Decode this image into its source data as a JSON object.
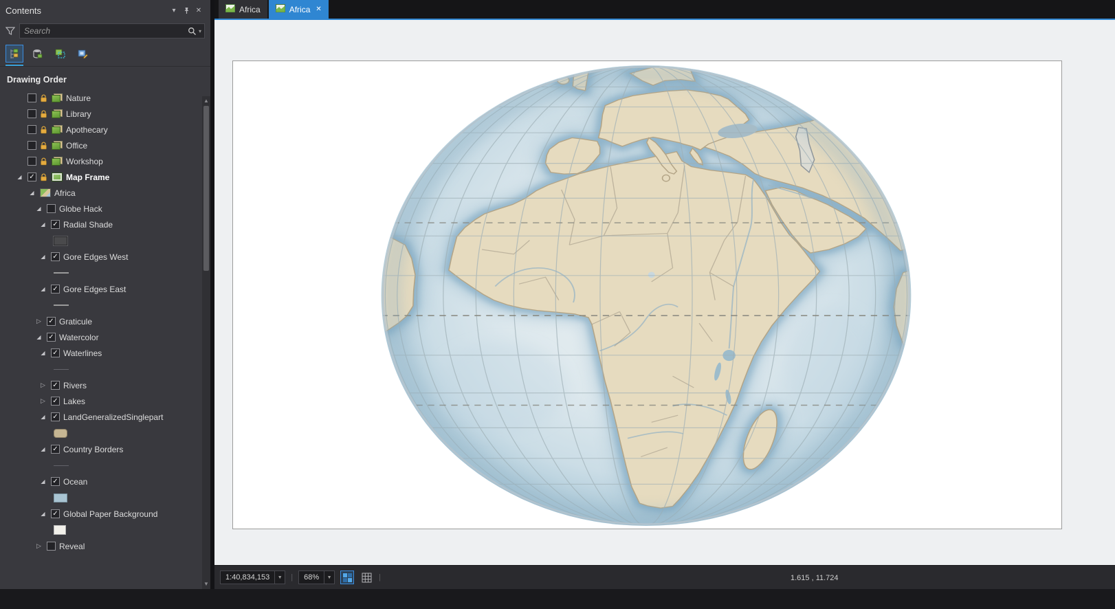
{
  "colors": {
    "accent": "#2f86d2",
    "panel_bg": "#39393e",
    "land": "#e6dbbf",
    "ocean_edge": "#9dbdd0"
  },
  "contents_panel": {
    "title": "Contents",
    "search_placeholder": "Search",
    "heading": "Drawing Order",
    "toolbar": [
      {
        "name": "list-by-drawing-order",
        "selected": true
      },
      {
        "name": "list-by-data-source",
        "selected": false
      },
      {
        "name": "list-by-selection",
        "selected": false
      },
      {
        "name": "list-by-editing",
        "selected": false
      }
    ],
    "tree": [
      {
        "label": "Nature",
        "level": 1,
        "expander": "none",
        "checkbox": false,
        "lock": true,
        "icon": "group",
        "bold": false,
        "swatch": null
      },
      {
        "label": "Library",
        "level": 1,
        "expander": "none",
        "checkbox": false,
        "lock": true,
        "icon": "group",
        "bold": false,
        "swatch": null
      },
      {
        "label": "Apothecary",
        "level": 1,
        "expander": "none",
        "checkbox": false,
        "lock": true,
        "icon": "group",
        "bold": false,
        "swatch": null
      },
      {
        "label": "Office",
        "level": 1,
        "expander": "none",
        "checkbox": false,
        "lock": true,
        "icon": "group",
        "bold": false,
        "swatch": null
      },
      {
        "label": "Workshop",
        "level": 1,
        "expander": "none",
        "checkbox": false,
        "lock": true,
        "icon": "group",
        "bold": false,
        "swatch": null
      },
      {
        "label": "Map Frame",
        "level": 1,
        "expander": "open",
        "checkbox": true,
        "lock": true,
        "icon": "frame",
        "bold": true,
        "swatch": null
      },
      {
        "label": "Africa",
        "level": 2,
        "expander": "open",
        "checkbox": null,
        "lock": false,
        "icon": "map",
        "bold": false,
        "swatch": null
      },
      {
        "label": "Globe Hack",
        "level": 3,
        "expander": "open",
        "checkbox": false,
        "lock": false,
        "icon": null,
        "bold": false,
        "swatch": null
      },
      {
        "label": "Radial Shade",
        "level": 4,
        "expander": "open",
        "checkbox": true,
        "lock": false,
        "icon": null,
        "bold": false,
        "swatch": "dark"
      },
      {
        "label": "Gore Edges West",
        "level": 4,
        "expander": "open",
        "checkbox": true,
        "lock": false,
        "icon": null,
        "bold": false,
        "swatch": "line"
      },
      {
        "label": "Gore Edges East",
        "level": 4,
        "expander": "open",
        "checkbox": true,
        "lock": false,
        "icon": null,
        "bold": false,
        "swatch": "line"
      },
      {
        "label": "Graticule",
        "level": 3,
        "expander": "closed",
        "checkbox": true,
        "lock": false,
        "icon": null,
        "bold": false,
        "swatch": null
      },
      {
        "label": "Watercolor",
        "level": 3,
        "expander": "open",
        "checkbox": true,
        "lock": false,
        "icon": null,
        "bold": false,
        "swatch": null
      },
      {
        "label": "Waterlines",
        "level": 4,
        "expander": "open",
        "checkbox": true,
        "lock": false,
        "icon": null,
        "bold": false,
        "swatch": "faintline"
      },
      {
        "label": "Rivers",
        "level": 4,
        "expander": "closed",
        "checkbox": true,
        "lock": false,
        "icon": null,
        "bold": false,
        "swatch": null
      },
      {
        "label": "Lakes",
        "level": 4,
        "expander": "closed",
        "checkbox": true,
        "lock": false,
        "icon": null,
        "bold": false,
        "swatch": null
      },
      {
        "label": "LandGeneralizedSinglepart",
        "level": 4,
        "expander": "open",
        "checkbox": true,
        "lock": false,
        "icon": null,
        "bold": false,
        "swatch": "tan"
      },
      {
        "label": "Country Borders",
        "level": 4,
        "expander": "open",
        "checkbox": true,
        "lock": false,
        "icon": null,
        "bold": false,
        "swatch": "faintline"
      },
      {
        "label": "Ocean",
        "level": 4,
        "expander": "open",
        "checkbox": true,
        "lock": false,
        "icon": null,
        "bold": false,
        "swatch": "blue"
      },
      {
        "label": "Global Paper Background",
        "level": 4,
        "expander": "open",
        "checkbox": true,
        "lock": false,
        "icon": null,
        "bold": false,
        "swatch": "white"
      },
      {
        "label": "Reveal",
        "level": 3,
        "expander": "closed",
        "checkbox": false,
        "lock": false,
        "icon": null,
        "bold": false,
        "swatch": null
      }
    ]
  },
  "tabs": [
    {
      "label": "Africa",
      "active": false,
      "closable": false
    },
    {
      "label": "Africa",
      "active": true,
      "closable": true
    }
  ],
  "status_bar": {
    "scale": "1:40,834,153",
    "zoom": "68%",
    "coordinates": "1.615 , 11.724"
  }
}
